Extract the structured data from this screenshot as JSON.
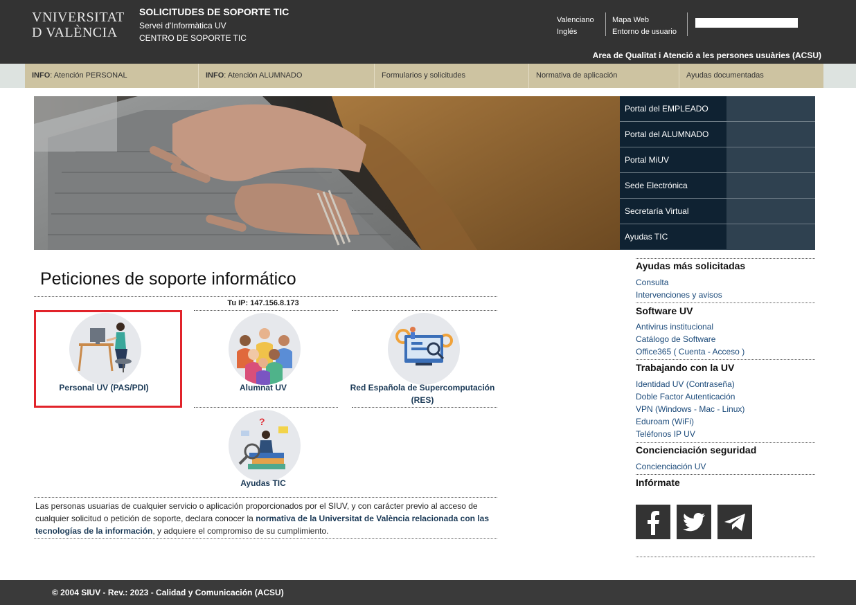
{
  "header": {
    "logo_line1": "VNIVERSITAT",
    "logo_line2": "D VALÈNCIA",
    "title": "SOLICITUDES DE SOPORTE TIC",
    "subtitle1": "Servei d'Informàtica UV",
    "subtitle2": "CENTRO DE SOPORTE TIC",
    "lang_links": [
      "Valenciano",
      "Inglés"
    ],
    "site_links": [
      "Mapa Web",
      "Entorno de usuario"
    ],
    "search_value": "",
    "area": "Area de Qualitat i Atenció a les persones usuàries (ACSU)"
  },
  "nav": {
    "items": [
      {
        "prefix": "INFO",
        "label": ": Atención PERSONAL"
      },
      {
        "prefix": "INFO",
        "label": ": Atención ALUMNADO"
      },
      {
        "prefix": "",
        "label": "Formularios y solicitudes"
      },
      {
        "prefix": "",
        "label": "Normativa de aplicación"
      },
      {
        "prefix": "",
        "label": "Ayudas documentadas"
      }
    ]
  },
  "portals": [
    "Portal del EMPLEADO",
    "Portal del ALUMNADO",
    "Portal MiUV",
    "Sede Electrónica",
    "Secretaría Virtual",
    "Ayudas TIC"
  ],
  "main": {
    "title": "Peticiones de soporte informático",
    "ip": "Tu IP: 147.156.8.173",
    "services": [
      {
        "label": "Personal UV (PAS/PDI)",
        "icon": "office-worker-icon"
      },
      {
        "label": "Alumnat UV",
        "icon": "students-group-icon"
      },
      {
        "label": "Red Española de Supercomputación (RES)",
        "icon": "supercomputing-icon"
      },
      {
        "label": "Ayudas TIC",
        "icon": "help-search-icon"
      }
    ],
    "disclaimer": {
      "text1": "Las personas usuarias de cualquier servicio o aplicación proporcionados por el SIUV, y con carácter previo al acceso de cualquier solicitud o petición de soporte, declara conocer la ",
      "link": "normativa de la Universitat de València relacionada con las tecnologías de la información",
      "text2": ", y adquiere el compromiso de su cumplimiento."
    }
  },
  "sidebar": {
    "sections": [
      {
        "title": "Ayudas más solicitadas",
        "links": [
          "Consulta",
          "Intervenciones y avisos"
        ]
      },
      {
        "title": "Software UV",
        "links": [
          "Antivirus institucional",
          "Catálogo de Software",
          "Office365 ( Cuenta - Acceso )"
        ]
      },
      {
        "title": "Trabajando con la UV",
        "links": [
          "Identidad UV (Contraseña)",
          "Doble Factor Autenticación",
          "VPN (Windows - Mac - Linux)",
          "Eduroam (WiFi)",
          "Teléfonos IP UV"
        ]
      },
      {
        "title": "Concienciación seguridad",
        "links": [
          "Concienciación UV"
        ]
      },
      {
        "title": "Infórmate",
        "links": []
      }
    ],
    "social": [
      "facebook-icon",
      "twitter-icon",
      "telegram-icon"
    ]
  },
  "footer": {
    "text": "© 2004 SIUV - Rev.: 2023 - Calidad y Comunicación (ACSU)"
  },
  "colors": {
    "header_bg": "#333333",
    "nav_bg": "#cdc3a1",
    "portal_dark": "#0f2232",
    "portal_light": "#2f4150",
    "highlight": "#e1232a",
    "link": "#1b3a57"
  }
}
